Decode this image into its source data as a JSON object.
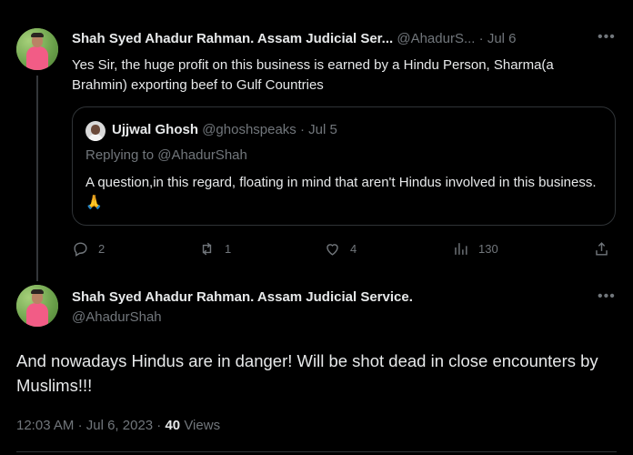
{
  "reply_tweet": {
    "author_name": "Shah Syed Ahadur Rahman. Assam Judicial Ser...",
    "handle": "@AhadurS...",
    "separator": "·",
    "date": "Jul 6",
    "text": "Yes Sir, the huge profit on this business is earned by a Hindu Person, Sharma(a Brahmin) exporting beef to Gulf Countries"
  },
  "quoted_tweet": {
    "author_name": "Ujjwal Ghosh",
    "handle": "@ghoshspeaks",
    "separator": "·",
    "date": "Jul 5",
    "replying_to": "Replying to @AhadurShah",
    "text": "A question,in this regard, floating in mind that aren't Hindus involved  in this business.🙏"
  },
  "actions": {
    "replies": "2",
    "retweets": "1",
    "likes": "4",
    "views": "130"
  },
  "main_tweet": {
    "author_name": "Shah Syed Ahadur Rahman. Assam Judicial Service.",
    "handle": "@AhadurShah",
    "text": "And nowadays Hindus are in danger! Will be shot dead in close encounters by Muslims!!!",
    "time": "12:03 AM",
    "date": "Jul 6, 2023",
    "views_count": "40",
    "views_label": "Views",
    "separator": "·"
  },
  "icons": {
    "more": "more-horizontal-icon",
    "reply": "reply-icon",
    "retweet": "retweet-icon",
    "like": "heart-icon",
    "views": "views-chart-icon",
    "share": "share-icon"
  },
  "colors": {
    "background": "#000000",
    "text": "#e7e9ea",
    "muted": "#71767b",
    "border": "#2f3336"
  }
}
